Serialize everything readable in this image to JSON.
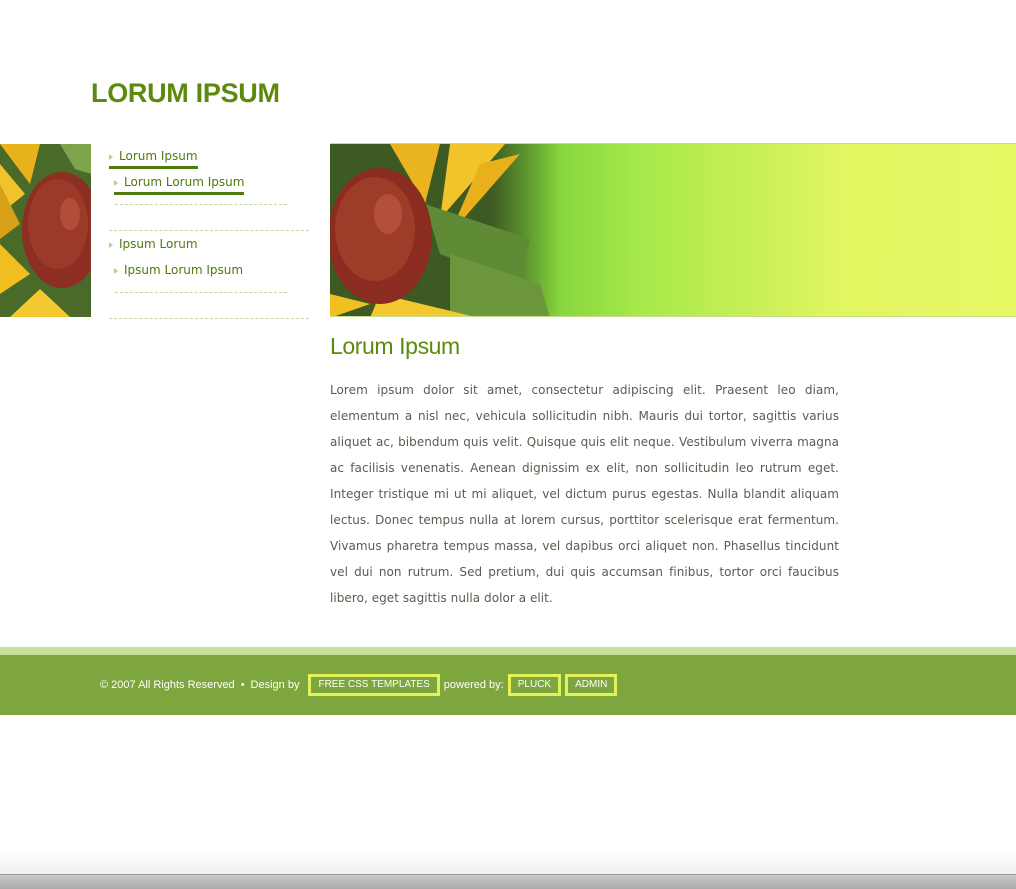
{
  "site": {
    "title": "LORUM IPSUM"
  },
  "sidebar": {
    "items": [
      {
        "label": "Lorum Ipsum"
      },
      {
        "label": "Lorum Lorum Ipsum"
      },
      {
        "label": "Ipsum Lorum"
      },
      {
        "label": "Ipsum Lorum Ipsum"
      }
    ]
  },
  "content": {
    "title": "Lorum Ipsum",
    "body": "Lorem ipsum dolor sit amet, consectetur adipiscing elit. Praesent leo diam, elementum a nisl nec, vehicula sollicitudin nibh. Mauris dui tortor, sagittis varius aliquet ac, bibendum quis velit. Quisque quis elit neque. Vestibulum viverra magna ac facilisis venenatis. Aenean dignissim ex elit, non sollicitudin leo rutrum eget. Integer tristique mi ut mi aliquet, vel dictum purus egestas. Nulla blandit aliquam lectus. Donec tempus nulla at lorem cursus, porttitor scelerisque erat fermentum. Vivamus pharetra tempus massa, vel dapibus orci aliquet non. Phasellus tincidunt vel dui non rutrum. Sed pretium, dui quis accumsan finibus, tortor orci faucibus libero, eget sagittis nulla dolor a elit."
  },
  "footer": {
    "copyright": "© 2007 All Rights Reserved",
    "separator": "•",
    "design_by": "Design by",
    "templates_link": "FREE CSS TEMPLATES",
    "powered_by": "powered by:",
    "pluck_link": "PLUCK",
    "admin_link": "ADMIN"
  },
  "colors": {
    "accent": "#5b8a0e",
    "footer_bg": "#7ea63e",
    "footer_stripe": "#c6e09c",
    "button_border": "#e4f25a"
  },
  "icons": {
    "menu_bullet": "triangle-right-icon"
  }
}
